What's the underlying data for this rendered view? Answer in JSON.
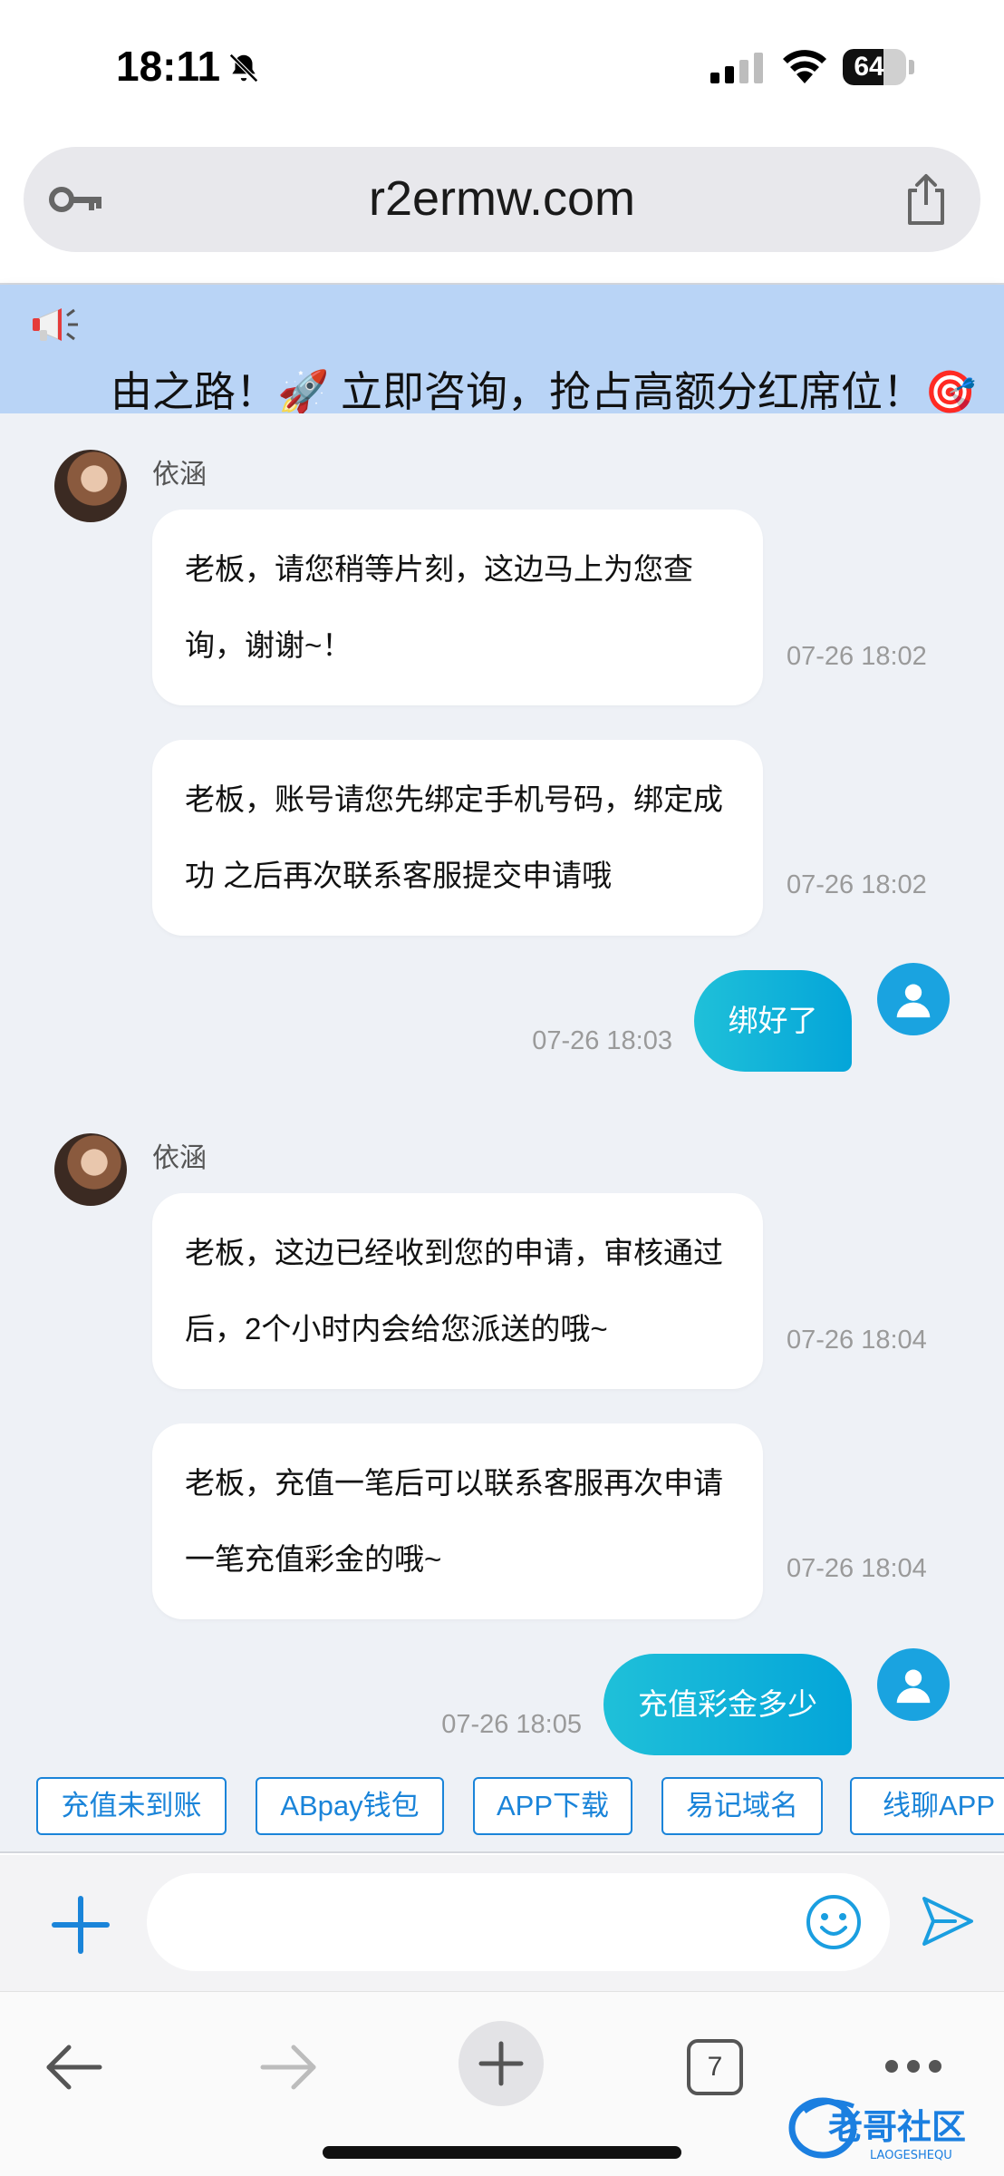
{
  "status_bar": {
    "time": "18:11",
    "battery_level": "64",
    "battery_fraction": 0.64
  },
  "browser": {
    "url": "r2ermw.com",
    "open_tab_count": "7"
  },
  "banner": {
    "text": "由之路！🚀 立即咨询，抢占高额分红席位！🎯"
  },
  "chat": {
    "messages": [
      {
        "sender": "agent",
        "name": "依涵",
        "text": "老板，请您稍等片刻，这边马上为您查询，谢谢~！",
        "time": "07-26 18:02"
      },
      {
        "sender": "agent",
        "text": "老板，账号请您先绑定手机号码，绑定成功 之后再次联系客服提交申请哦",
        "time": "07-26 18:02"
      },
      {
        "sender": "user",
        "text": "绑好了",
        "time": "07-26 18:03"
      },
      {
        "sender": "agent",
        "name": "依涵",
        "text": "老板，这边已经收到您的申请，审核通过后，2个小时内会给您派送的哦~",
        "time": "07-26 18:04"
      },
      {
        "sender": "agent",
        "text": "老板，充值一笔后可以联系客服再次申请一笔充值彩金的哦~",
        "time": "07-26 18:04"
      },
      {
        "sender": "user",
        "text": "充值彩金多少",
        "time": "07-26 18:05"
      }
    ]
  },
  "quick_replies": [
    "充值未到账",
    "ABpay钱包",
    "APP下载",
    "易记域名",
    "线聊APP"
  ],
  "input": {
    "placeholder": ""
  },
  "watermark": {
    "text": "老哥社区",
    "subtext": "LAOGESHEQU"
  },
  "colors": {
    "accent": "#1a84d9",
    "user_bubble": "#0ab0da",
    "banner_bg": "#b9d4f6",
    "chat_bg": "#eef1f6"
  },
  "icons": {
    "status": [
      "bell-off-icon",
      "signal-icon",
      "wifi-icon",
      "battery-icon"
    ],
    "url_bar": [
      "key-icon",
      "share-icon"
    ],
    "banner": [
      "megaphone-icon"
    ],
    "input_bar": [
      "plus-icon",
      "emoji-icon",
      "send-icon"
    ],
    "toolbar": [
      "back-arrow-icon",
      "forward-arrow-icon",
      "new-tab-icon",
      "tabs-icon",
      "more-icon"
    ]
  }
}
